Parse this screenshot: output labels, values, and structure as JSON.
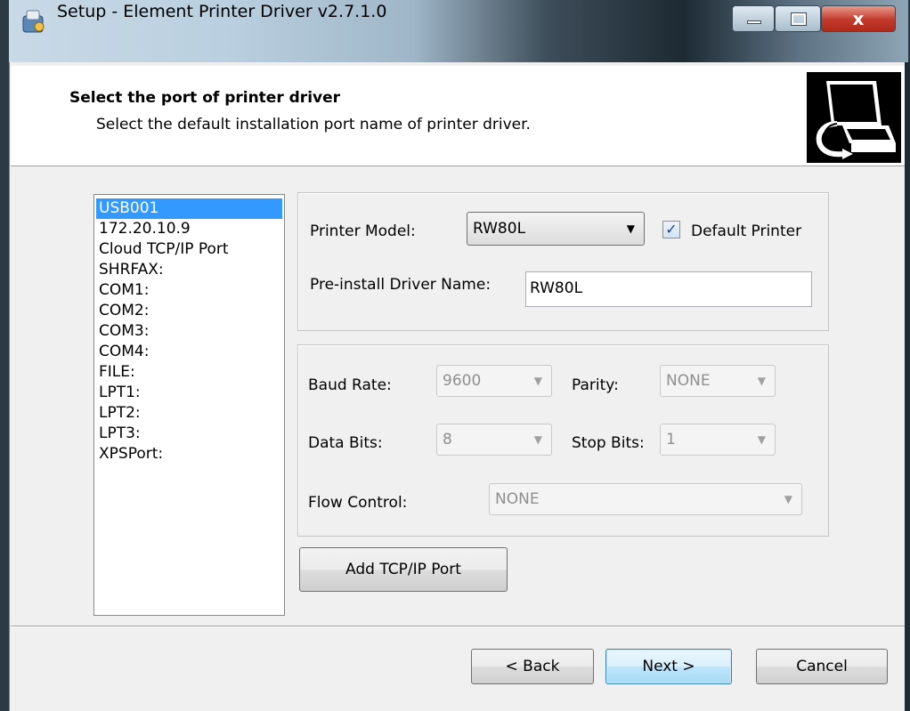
{
  "window": {
    "title": "Setup - Element Printer Driver v2.7.1.0",
    "close_glyph": "x",
    "minimize_glyph": "",
    "maximize_glyph": ""
  },
  "header": {
    "title": "Select the port of printer driver",
    "subtitle": "Select the default installation port name of printer driver."
  },
  "ports": [
    "USB001",
    "172.20.10.9",
    "Cloud TCP/IP Port",
    "SHRFAX:",
    "COM1:",
    "COM2:",
    "COM3:",
    "COM4:",
    "FILE:",
    "LPT1:",
    "LPT2:",
    "LPT3:",
    "XPSPort:"
  ],
  "selected_port": "USB001",
  "model": {
    "printer_model_label": "Printer Model:",
    "printer_model_value": "RW80L",
    "default_printer_label": "Default Printer",
    "default_printer_checked": true,
    "driver_name_label": "Pre-install Driver Name:",
    "driver_name_value": "RW80L"
  },
  "serial": {
    "baud_rate_label": "Baud Rate:",
    "baud_rate_value": "9600",
    "parity_label": "Parity:",
    "parity_value": "NONE",
    "data_bits_label": "Data Bits:",
    "data_bits_value": "8",
    "stop_bits_label": "Stop Bits:",
    "stop_bits_value": "1",
    "flow_control_label": "Flow Control:",
    "flow_control_value": "NONE"
  },
  "buttons": {
    "add_tcpip": "Add TCP/IP Port",
    "back": "< Back",
    "next": "Next >",
    "cancel": "Cancel"
  },
  "icons": {
    "app": "setup-icon",
    "header": "printer-install-icon",
    "dropdown": "chevron-down-icon",
    "checkbox": "check-icon"
  }
}
